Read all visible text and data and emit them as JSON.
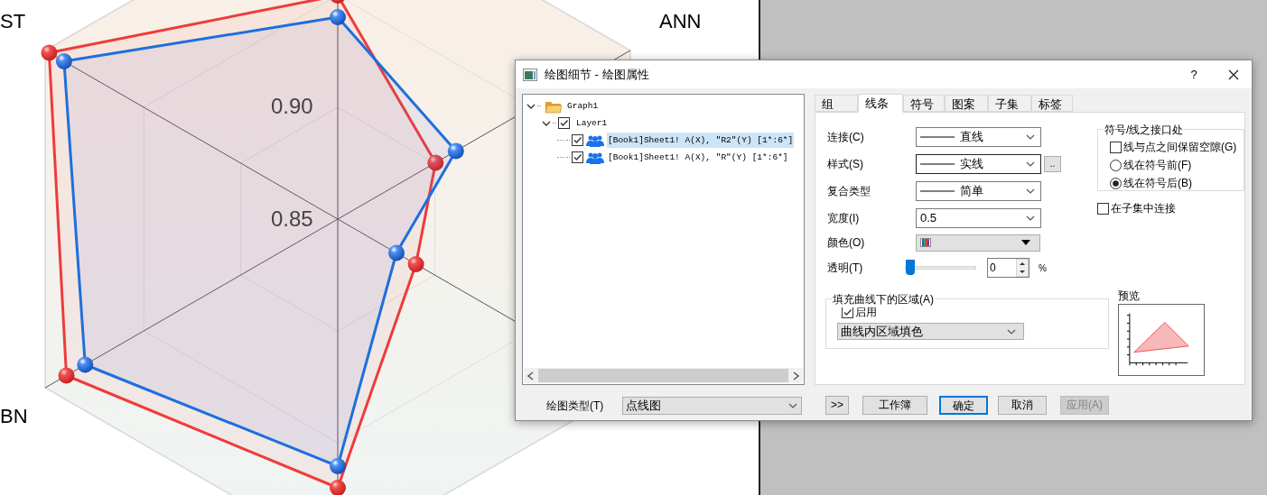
{
  "chart": {
    "axis_labels": [
      "ST",
      "ANN",
      "BN"
    ],
    "ring_labels": [
      "0.90",
      "0.85"
    ]
  },
  "dialog": {
    "title": "绘图细节 - 绘图属性",
    "help": "?",
    "tree": [
      {
        "label": "Graph1",
        "kind": "folder",
        "expanded": true,
        "children": [
          {
            "label": "Layer1",
            "kind": "layer",
            "expanded": true,
            "checked": true,
            "children": [
              {
                "label": "[Book1]Sheet1! A(X), \"R2\"(Y) [1*:6*]",
                "kind": "plot",
                "checked": true,
                "selected": true
              },
              {
                "label": "[Book1]Sheet1! A(X), \"R\"(Y) [1*:6*]",
                "kind": "plot",
                "checked": true,
                "selected": false
              }
            ]
          }
        ]
      }
    ],
    "plot_type": {
      "label": "绘图类型(T)",
      "value": "点线图"
    },
    "tabs": [
      {
        "label": "组",
        "selected": false
      },
      {
        "label": "线条",
        "selected": true
      },
      {
        "label": "符号",
        "selected": false
      },
      {
        "label": "图案",
        "selected": false
      },
      {
        "label": "子集",
        "selected": false
      },
      {
        "label": "标签",
        "selected": false
      }
    ],
    "fields": [
      {
        "kind": "line_dropdown",
        "label": "连接(C)",
        "value": "直线",
        "focused": false
      },
      {
        "kind": "line_dropdown",
        "label": "样式(S)",
        "value": "实线",
        "focused": true,
        "extra_button": ".."
      },
      {
        "kind": "line_dropdown",
        "label": "复合类型",
        "value": "简单",
        "focused": false
      },
      {
        "kind": "dropdown",
        "label": "宽度(I)",
        "value": "0.5",
        "focused": false
      },
      {
        "kind": "color",
        "label": "颜色(O)"
      },
      {
        "kind": "slider",
        "label": "透明(T)",
        "level": 0,
        "value": "0",
        "unit": "%"
      }
    ],
    "joint_group": {
      "title": "符号/线之接口处",
      "options": [
        {
          "kind": "checkbox",
          "label": "线与点之间保留空隙(G)",
          "checked": false
        },
        {
          "kind": "radio",
          "label": "线在符号前(F)",
          "selected": false
        },
        {
          "kind": "radio",
          "label": "线在符号后(B)",
          "selected": true
        }
      ]
    },
    "subset_connect": {
      "label": "在子集中连接",
      "checked": false
    },
    "fill_group": {
      "title": "填充曲线下的区域(A)",
      "enable": {
        "label": "启用",
        "checked": true
      },
      "mode": "曲线内区域填色"
    },
    "preview": {
      "label": "预览"
    },
    "buttons": [
      {
        "label": ">>",
        "default": false,
        "disabled": false
      },
      {
        "label": "工作簿",
        "default": false,
        "disabled": false
      },
      {
        "label": "确定",
        "default": true,
        "disabled": false
      },
      {
        "label": "取消",
        "default": false,
        "disabled": false
      },
      {
        "label": "应用(A)",
        "default": false,
        "disabled": true
      }
    ]
  }
}
